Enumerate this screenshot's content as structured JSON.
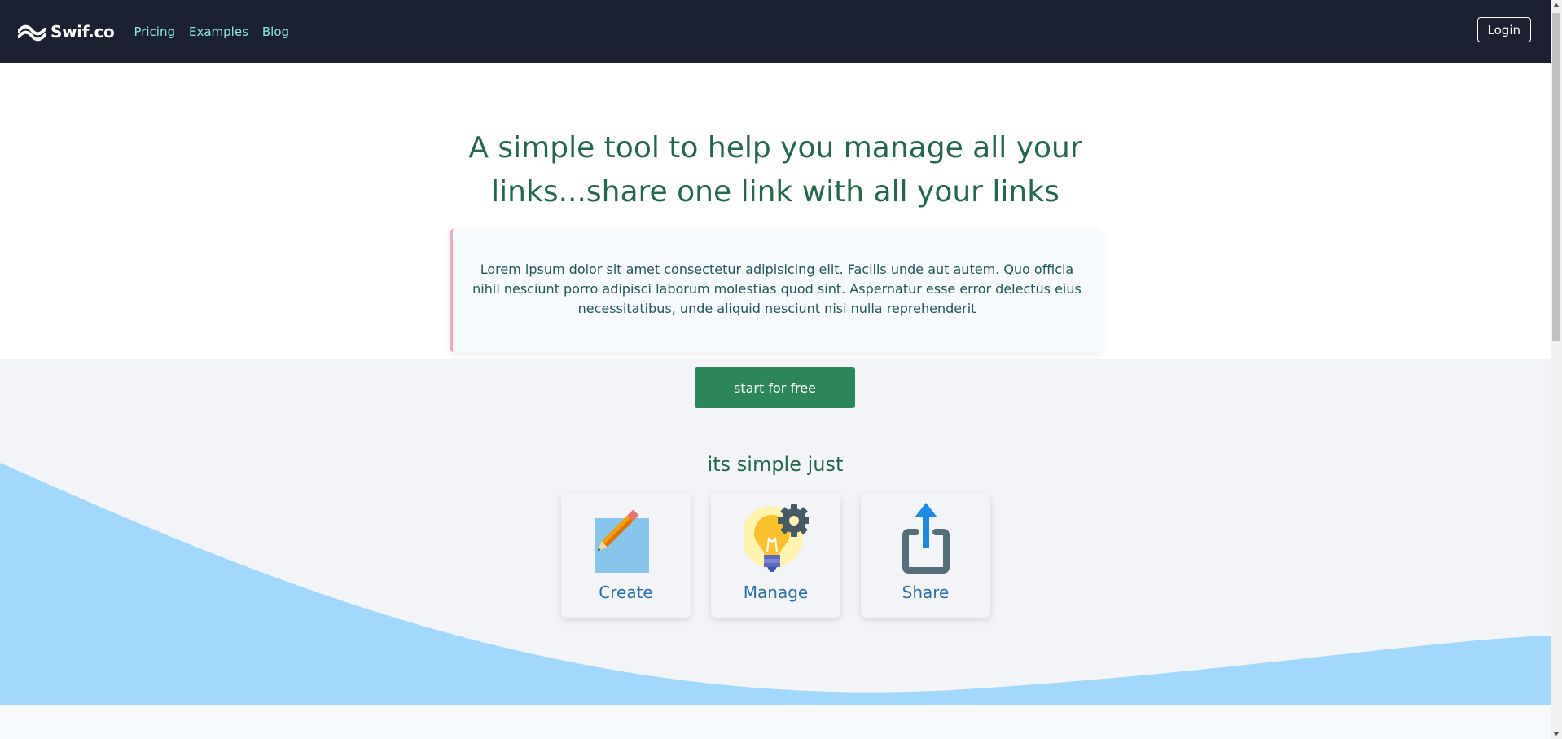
{
  "nav": {
    "brand": "Swif.co",
    "links": [
      {
        "label": "Pricing"
      },
      {
        "label": "Examples"
      },
      {
        "label": "Blog"
      }
    ],
    "login_label": "Login"
  },
  "hero": {
    "headline": "A simple tool to help you manage all your links...share one link with all your links",
    "description": "Lorem ipsum dolor sit amet consectetur adipisicing elit. Facilis unde aut autem. Quo officia nihil nesciunt porro adipisci laborum molestias quod sint. Aspernatur esse error delectus eius necessitatibus, unde aliquid nesciunt nisi nulla reprehenderit",
    "cta_label": "start for free"
  },
  "steps": {
    "title": "its simple just",
    "items": [
      {
        "label": "Create",
        "icon": "pencil-icon"
      },
      {
        "label": "Manage",
        "icon": "lightbulb-gear-icon"
      },
      {
        "label": "Share",
        "icon": "share-icon"
      }
    ]
  },
  "colors": {
    "navbar": "#1b2130",
    "nav_link": "#8ee6d7",
    "headline": "#24684c",
    "cta": "#2d8659",
    "wave": "#a2d8fb",
    "step_label": "#2c6fb0",
    "accent_border": "#f4a8bf"
  }
}
